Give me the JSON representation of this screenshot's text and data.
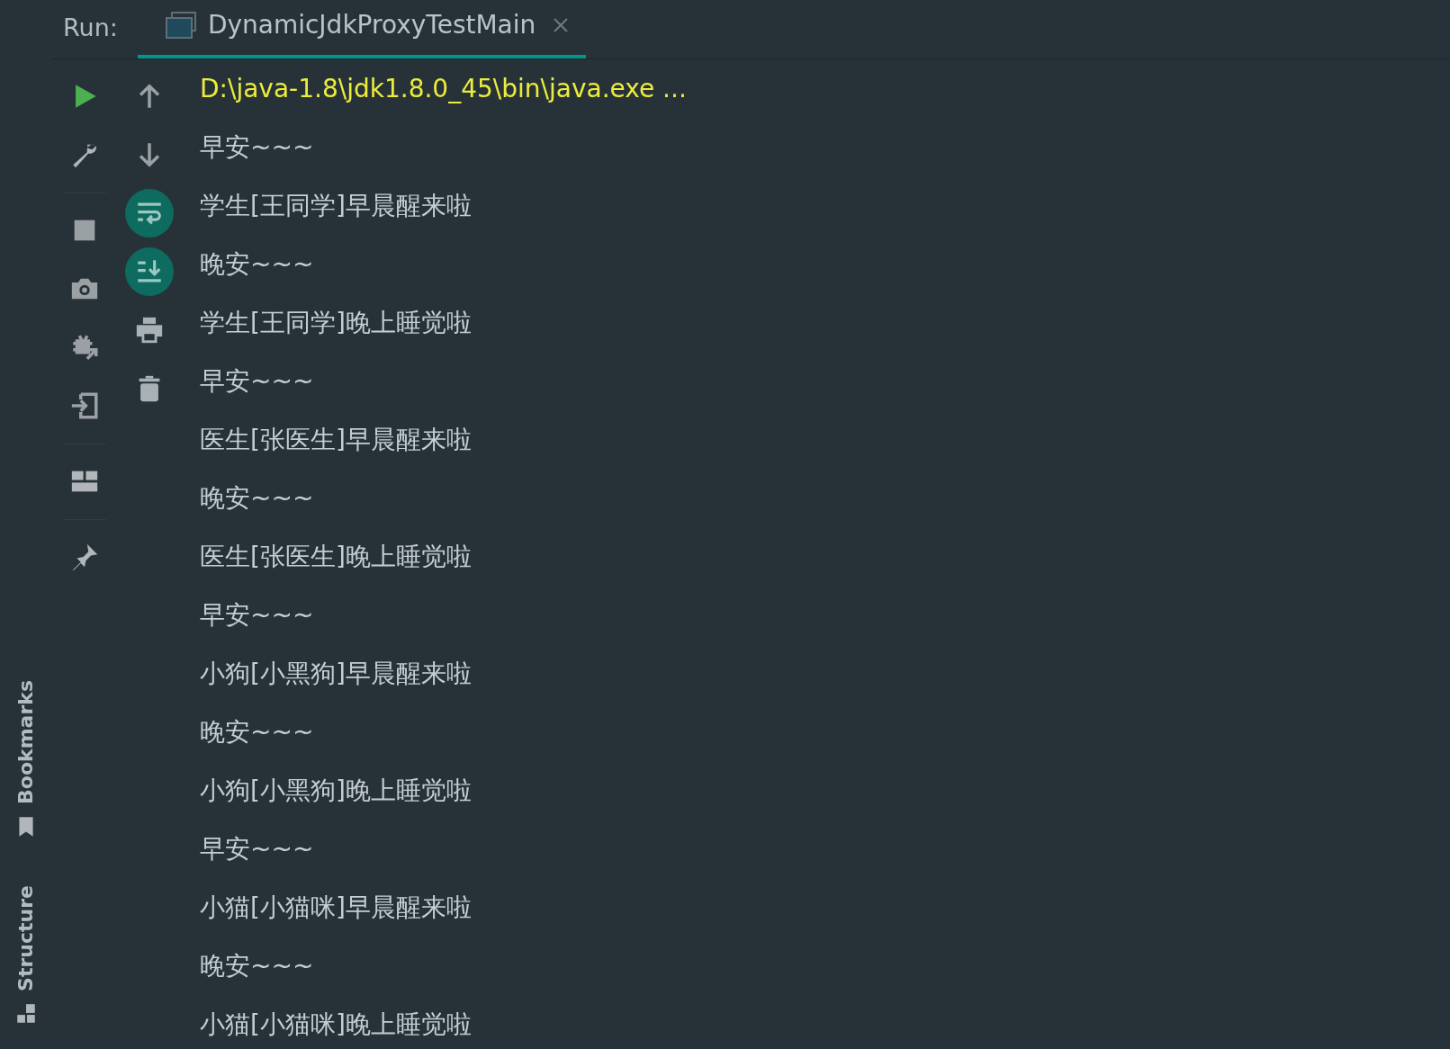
{
  "side_tabs": [
    {
      "label": "Bookmarks",
      "kind": "bookmarks"
    },
    {
      "label": "Structure",
      "kind": "structure"
    }
  ],
  "run_label": "Run:",
  "tabs": [
    {
      "label": "DynamicJdkProxyTestMain",
      "selected": true
    }
  ],
  "toggles": [
    {
      "kind": "soft-wrap",
      "on": true
    },
    {
      "kind": "scroll-to-end",
      "on": true
    }
  ],
  "console_lines": [
    {
      "kind": "command",
      "text": "D:\\java-1.8\\jdk1.8.0_45\\bin\\java.exe ..."
    },
    {
      "kind": "output",
      "text": "早安~~~"
    },
    {
      "kind": "output",
      "text": "学生[王同学]早晨醒来啦"
    },
    {
      "kind": "output",
      "text": "晚安~~~"
    },
    {
      "kind": "output",
      "text": "学生[王同学]晚上睡觉啦"
    },
    {
      "kind": "output",
      "text": "早安~~~"
    },
    {
      "kind": "output",
      "text": "医生[张医生]早晨醒来啦"
    },
    {
      "kind": "output",
      "text": "晚安~~~"
    },
    {
      "kind": "output",
      "text": "医生[张医生]晚上睡觉啦"
    },
    {
      "kind": "output",
      "text": "早安~~~"
    },
    {
      "kind": "output",
      "text": "小狗[小黑狗]早晨醒来啦"
    },
    {
      "kind": "output",
      "text": "晚安~~~"
    },
    {
      "kind": "output",
      "text": "小狗[小黑狗]晚上睡觉啦"
    },
    {
      "kind": "output",
      "text": "早安~~~"
    },
    {
      "kind": "output",
      "text": "小猫[小猫咪]早晨醒来啦"
    },
    {
      "kind": "output",
      "text": "晚安~~~"
    },
    {
      "kind": "output",
      "text": "小猫[小猫咪]晚上睡觉啦"
    }
  ]
}
